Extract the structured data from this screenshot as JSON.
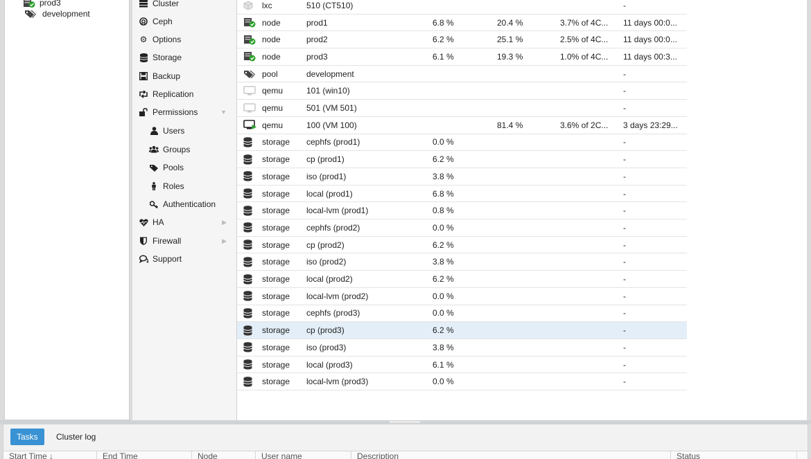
{
  "tree": {
    "items": [
      {
        "label": "prod3",
        "icon": "node-online-icon"
      },
      {
        "label": "development",
        "icon": "pool-tag-icon"
      }
    ]
  },
  "menu": {
    "items": [
      {
        "label": "Cluster",
        "icon": "server-icon",
        "sub": false
      },
      {
        "label": "Ceph",
        "icon": "ceph-icon",
        "sub": false
      },
      {
        "label": "Options",
        "icon": "gear-icon",
        "sub": false
      },
      {
        "label": "Storage",
        "icon": "database-icon",
        "sub": false
      },
      {
        "label": "Backup",
        "icon": "floppy-icon",
        "sub": false
      },
      {
        "label": "Replication",
        "icon": "retweet-icon",
        "sub": false
      },
      {
        "label": "Permissions",
        "icon": "unlock-icon",
        "sub": false,
        "arrow": "down"
      },
      {
        "label": "Users",
        "icon": "user-icon",
        "sub": true
      },
      {
        "label": "Groups",
        "icon": "users-icon",
        "sub": true
      },
      {
        "label": "Pools",
        "icon": "tags-icon",
        "sub": true
      },
      {
        "label": "Roles",
        "icon": "male-icon",
        "sub": true
      },
      {
        "label": "Authentication",
        "icon": "key-icon",
        "sub": true
      },
      {
        "label": "HA",
        "icon": "heartbeat-icon",
        "sub": false,
        "arrow": "right"
      },
      {
        "label": "Firewall",
        "icon": "shield-icon",
        "sub": false,
        "arrow": "right"
      },
      {
        "label": "Support",
        "icon": "comments-icon",
        "sub": false
      }
    ]
  },
  "resources": {
    "rows": [
      {
        "icon": "container-icon",
        "type": "lxc",
        "desc": "510 (CT510)",
        "disk": "",
        "mem": "",
        "cpu": "",
        "uptime": "-"
      },
      {
        "icon": "node-online-icon",
        "type": "node",
        "desc": "prod1",
        "disk": "6.8 %",
        "mem": "20.4 %",
        "cpu": "3.7% of 4C...",
        "uptime": "11 days 00:0..."
      },
      {
        "icon": "node-online-icon",
        "type": "node",
        "desc": "prod2",
        "disk": "6.2 %",
        "mem": "25.1 %",
        "cpu": "2.5% of 4C...",
        "uptime": "11 days 00:0..."
      },
      {
        "icon": "node-online-icon",
        "type": "node",
        "desc": "prod3",
        "disk": "6.1 %",
        "mem": "19.3 %",
        "cpu": "1.0% of 4C...",
        "uptime": "11 days 00:3..."
      },
      {
        "icon": "pool-tag-icon",
        "type": "pool",
        "desc": "development",
        "disk": "",
        "mem": "",
        "cpu": "",
        "uptime": "-"
      },
      {
        "icon": "vm-stopped-icon",
        "type": "qemu",
        "desc": "101 (win10)",
        "disk": "",
        "mem": "",
        "cpu": "",
        "uptime": "-"
      },
      {
        "icon": "vm-stopped-icon",
        "type": "qemu",
        "desc": "501 (VM 501)",
        "disk": "",
        "mem": "",
        "cpu": "",
        "uptime": "-"
      },
      {
        "icon": "vm-running-icon",
        "type": "qemu",
        "desc": "100 (VM 100)",
        "disk": "",
        "mem": "81.4 %",
        "cpu": "3.6% of 2C...",
        "uptime": "3 days 23:29..."
      },
      {
        "icon": "storage-icon",
        "type": "storage",
        "desc": "cephfs (prod1)",
        "disk": "0.0 %",
        "mem": "",
        "cpu": "",
        "uptime": "-"
      },
      {
        "icon": "storage-icon",
        "type": "storage",
        "desc": "cp (prod1)",
        "disk": "6.2 %",
        "mem": "",
        "cpu": "",
        "uptime": "-"
      },
      {
        "icon": "storage-icon",
        "type": "storage",
        "desc": "iso (prod1)",
        "disk": "3.8 %",
        "mem": "",
        "cpu": "",
        "uptime": "-"
      },
      {
        "icon": "storage-icon",
        "type": "storage",
        "desc": "local (prod1)",
        "disk": "6.8 %",
        "mem": "",
        "cpu": "",
        "uptime": "-"
      },
      {
        "icon": "storage-icon",
        "type": "storage",
        "desc": "local-lvm (prod1)",
        "disk": "0.8 %",
        "mem": "",
        "cpu": "",
        "uptime": "-"
      },
      {
        "icon": "storage-icon",
        "type": "storage",
        "desc": "cephfs (prod2)",
        "disk": "0.0 %",
        "mem": "",
        "cpu": "",
        "uptime": "-"
      },
      {
        "icon": "storage-icon",
        "type": "storage",
        "desc": "cp (prod2)",
        "disk": "6.2 %",
        "mem": "",
        "cpu": "",
        "uptime": "-"
      },
      {
        "icon": "storage-icon",
        "type": "storage",
        "desc": "iso (prod2)",
        "disk": "3.8 %",
        "mem": "",
        "cpu": "",
        "uptime": "-"
      },
      {
        "icon": "storage-icon",
        "type": "storage",
        "desc": "local (prod2)",
        "disk": "6.2 %",
        "mem": "",
        "cpu": "",
        "uptime": "-"
      },
      {
        "icon": "storage-icon",
        "type": "storage",
        "desc": "local-lvm (prod2)",
        "disk": "0.0 %",
        "mem": "",
        "cpu": "",
        "uptime": "-"
      },
      {
        "icon": "storage-icon",
        "type": "storage",
        "desc": "cephfs (prod3)",
        "disk": "0.0 %",
        "mem": "",
        "cpu": "",
        "uptime": "-"
      },
      {
        "icon": "storage-icon",
        "type": "storage",
        "desc": "cp (prod3)",
        "disk": "6.2 %",
        "mem": "",
        "cpu": "",
        "uptime": "-",
        "selected": true
      },
      {
        "icon": "storage-icon",
        "type": "storage",
        "desc": "iso (prod3)",
        "disk": "3.8 %",
        "mem": "",
        "cpu": "",
        "uptime": "-"
      },
      {
        "icon": "storage-icon",
        "type": "storage",
        "desc": "local (prod3)",
        "disk": "6.1 %",
        "mem": "",
        "cpu": "",
        "uptime": "-"
      },
      {
        "icon": "storage-icon",
        "type": "storage",
        "desc": "local-lvm (prod3)",
        "disk": "0.0 %",
        "mem": "",
        "cpu": "",
        "uptime": "-"
      }
    ]
  },
  "bottom": {
    "tabs": [
      {
        "label": "Tasks",
        "active": true
      },
      {
        "label": "Cluster log",
        "active": false
      }
    ],
    "columns": [
      "Start Time ↓",
      "End Time",
      "Node",
      "User name",
      "Description",
      "Status"
    ]
  },
  "colors": {
    "accent": "#3892d3",
    "online": "#2ca02c",
    "selected_row": "#e3eef8"
  }
}
